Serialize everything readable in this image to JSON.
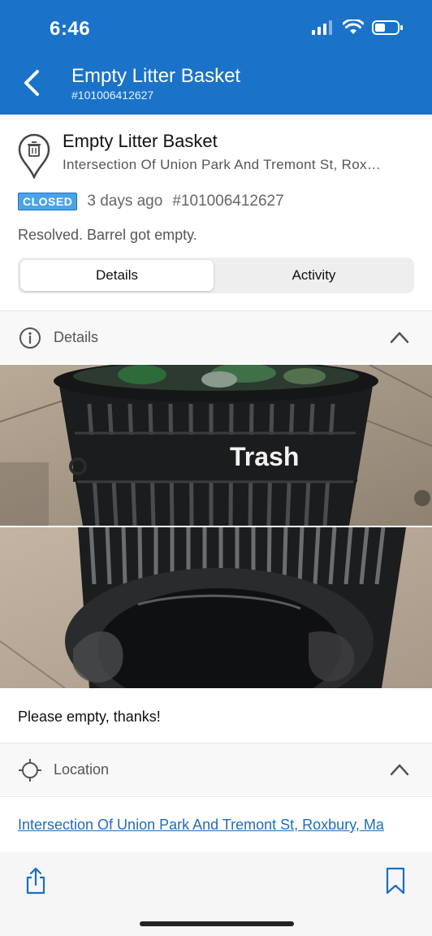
{
  "status_bar": {
    "time": "6:46"
  },
  "nav": {
    "title": "Empty Litter Basket",
    "subtitle": "#101006412627",
    "back_icon": "chevron-left-icon",
    "bar_color": "#1a73c8"
  },
  "request": {
    "title": "Empty Litter Basket",
    "address": "Intersection Of Union Park And Tremont St, Rox…",
    "status": "CLOSED",
    "age": "3 days ago",
    "id": "#101006412627",
    "resolution": "Resolved. Barrel got empty."
  },
  "tabs": [
    {
      "label": "Details",
      "active": true
    },
    {
      "label": "Activity",
      "active": false
    }
  ],
  "details_section": {
    "label": "Details",
    "icon": "info-icon",
    "expanded": true,
    "photo_text": "Trash",
    "description": "Please empty, thanks!"
  },
  "location_section": {
    "label": "Location",
    "icon": "crosshair-icon",
    "expanded": true,
    "address_link": "Intersection Of Union Park And Tremont St, Roxbury, Ma"
  },
  "bottom_bar": {
    "share_icon": "share-icon",
    "bookmark_icon": "bookmark-icon"
  }
}
